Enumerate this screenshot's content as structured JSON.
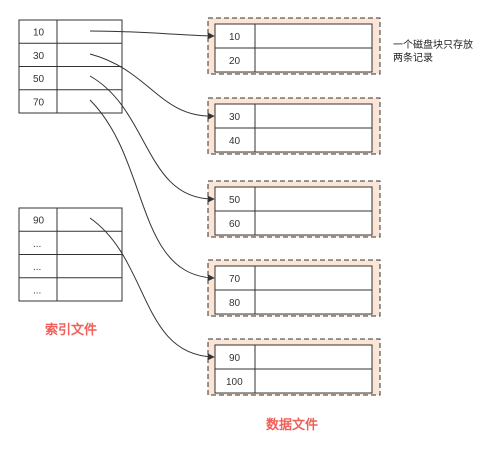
{
  "index_table_1": {
    "rows": [
      "10",
      "30",
      "50",
      "70"
    ]
  },
  "index_table_2": {
    "rows": [
      "90",
      "...",
      "...",
      "..."
    ]
  },
  "data_blocks": [
    {
      "records": [
        "10",
        "20"
      ]
    },
    {
      "records": [
        "30",
        "40"
      ]
    },
    {
      "records": [
        "50",
        "60"
      ]
    },
    {
      "records": [
        "70",
        "80"
      ]
    },
    {
      "records": [
        "90",
        "100"
      ]
    }
  ],
  "note": {
    "line1": "一个磁盘块只存放",
    "line2": "两条记录"
  },
  "captions": {
    "index_file": "索引文件",
    "data_file": "数据文件"
  },
  "colors": {
    "caption": "#f0605a",
    "block_fill": "#fbe5d6",
    "line": "#333333"
  }
}
